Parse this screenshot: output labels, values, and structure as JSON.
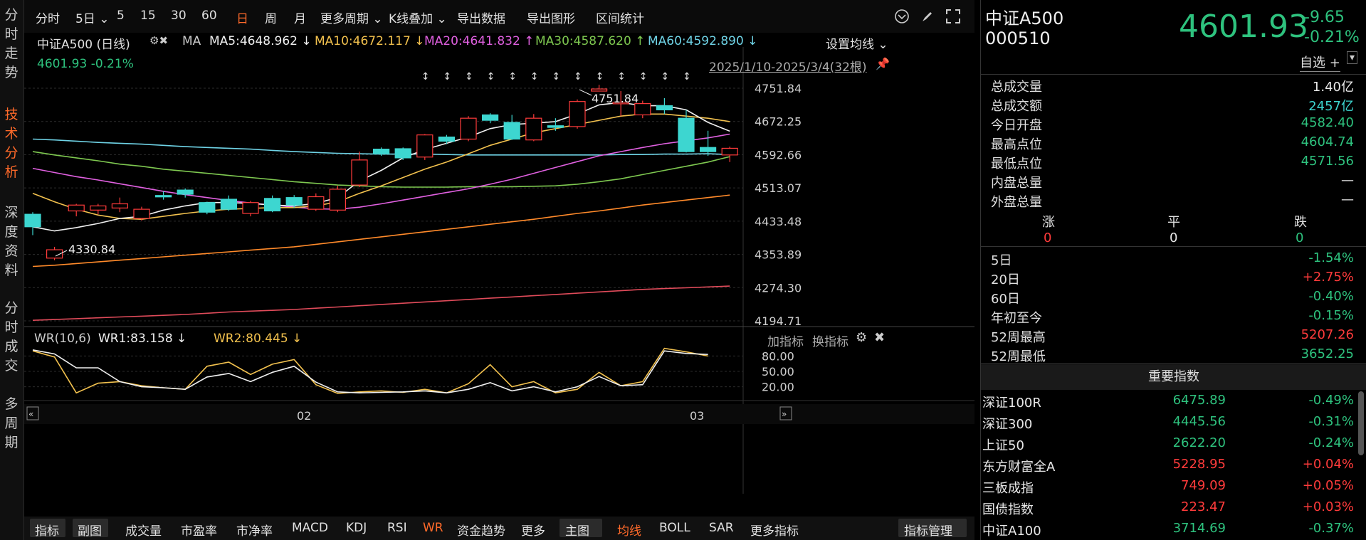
{
  "left_tabs": [
    "分时走势",
    "技术分析",
    "深度资料",
    "分时成交",
    "多周期"
  ],
  "toolbar": {
    "items": [
      "分时",
      "5日 ⌄",
      "5",
      "15",
      "30",
      "60",
      "日",
      "周",
      "月",
      "更多周期 ⌄",
      "K线叠加 ⌄",
      "导出数据",
      "导出图形",
      "区间统计"
    ]
  },
  "chart": {
    "title": "中证A500 (日线)",
    "ma_label": "MA",
    "ma5": "MA5:4648.962 ↓",
    "ma10": "MA10:4672.117 ↓",
    "ma20": "MA20:4641.832 ↑",
    "ma30": "MA30:4587.620 ↑",
    "ma60": "MA60:4592.890 ↓",
    "set_ma": "设置均线 ⌄",
    "last": "4601.93 -0.21%",
    "range": "2025/1/10-2025/3/4(32根)",
    "high_label": "4751.84",
    "low_label": "4330.84",
    "y_ticks": [
      "4751.84",
      "4672.25",
      "4592.66",
      "4513.07",
      "4433.48",
      "4353.89",
      "4274.30",
      "4194.71"
    ],
    "x_ticks": [
      "02",
      "03"
    ],
    "wr_title": "WR(10,6)",
    "wr1": "WR1:83.158 ↓",
    "wr2": "WR2:80.445 ↓",
    "wr_add": "加指标",
    "wr_change": "换指标",
    "wr_ticks": [
      "80.00",
      "50.00",
      "20.00"
    ]
  },
  "chart_data": {
    "type": "candlestick",
    "candles": [
      [
        4450,
        4420,
        4455,
        4400
      ],
      [
        4345,
        4365,
        4372,
        4340
      ],
      [
        4458,
        4472,
        4475,
        4445
      ],
      [
        4460,
        4470,
        4475,
        4450
      ],
      [
        4465,
        4475,
        4490,
        4455
      ],
      [
        4440,
        4462,
        4468,
        4435
      ],
      [
        4495,
        4492,
        4505,
        4485
      ],
      [
        4508,
        4498,
        4512,
        4490
      ],
      [
        4478,
        4455,
        4480,
        4450
      ],
      [
        4486,
        4462,
        4495,
        4458
      ],
      [
        4452,
        4478,
        4482,
        4445
      ],
      [
        4488,
        4458,
        4495,
        4455
      ],
      [
        4490,
        4472,
        4496,
        4465
      ],
      [
        4462,
        4492,
        4500,
        4458
      ],
      [
        4460,
        4510,
        4518,
        4455
      ],
      [
        4520,
        4580,
        4600,
        4515
      ],
      [
        4606,
        4595,
        4610,
        4590
      ],
      [
        4607,
        4585,
        4610,
        4580
      ],
      [
        4587,
        4640,
        4642,
        4580
      ],
      [
        4635,
        4625,
        4640,
        4618
      ],
      [
        4630,
        4680,
        4685,
        4625
      ],
      [
        4688,
        4675,
        4692,
        4668
      ],
      [
        4670,
        4630,
        4688,
        4628
      ],
      [
        4628,
        4680,
        4690,
        4625
      ],
      [
        4662,
        4658,
        4680,
        4650
      ],
      [
        4660,
        4720,
        4725,
        4655
      ],
      [
        4745,
        4750,
        4760,
        4745
      ],
      [
        4715,
        4718,
        4745,
        4685
      ],
      [
        4688,
        4715,
        4722,
        4680
      ],
      [
        4710,
        4700,
        4728,
        4690
      ],
      [
        4680,
        4600,
        4700,
        4598
      ],
      [
        4610,
        4600,
        4650,
        4590
      ],
      [
        4592,
        4608,
        4612,
        4575
      ]
    ],
    "wr1": [
      92,
      84,
      57,
      57,
      30,
      20,
      18,
      15,
      39,
      46,
      30,
      48,
      60,
      29,
      10,
      8,
      9,
      10,
      12,
      8,
      15,
      28,
      12,
      20,
      10,
      20,
      40,
      22,
      24,
      90,
      85,
      83
    ],
    "wr2": [
      90,
      78,
      8,
      27,
      30,
      22,
      18,
      15,
      60,
      68,
      44,
      64,
      73,
      24,
      7,
      10,
      12,
      9,
      15,
      8,
      26,
      63,
      20,
      30,
      8,
      15,
      48,
      22,
      30,
      95,
      88,
      80
    ]
  },
  "bottom_tabs": [
    "指标",
    "副图",
    "成交量",
    "市盈率",
    "市净率",
    "MACD",
    "KDJ",
    "RSI",
    "WR",
    "资金趋势",
    "更多",
    "主图",
    "均线",
    "BOLL",
    "SAR",
    "更多指标",
    "指标管理"
  ],
  "quote": {
    "name": "中证A500",
    "code": "000510",
    "price": "4601.93",
    "chg": "-9.65",
    "pct": "-0.21%",
    "watch": "自选 +"
  },
  "stats": [
    {
      "k": "总成交量",
      "v": "1.40亿",
      "c": "white"
    },
    {
      "k": "总成交额",
      "v": "2457亿",
      "c": "cyan"
    },
    {
      "k": "今日开盘",
      "v": "4582.40",
      "c": "green"
    },
    {
      "k": "最高点位",
      "v": "4604.74",
      "c": "green"
    },
    {
      "k": "最低点位",
      "v": "4571.56",
      "c": "green"
    },
    {
      "k": "内盘总量",
      "v": "—",
      "c": "white"
    },
    {
      "k": "外盘总量",
      "v": "—",
      "c": "white"
    }
  ],
  "breadth": {
    "up_l": "涨",
    "flat_l": "平",
    "down_l": "跌",
    "up": "0",
    "flat": "0",
    "down": "0"
  },
  "periods": [
    {
      "k": "5日",
      "v": "-1.54%",
      "c": "green"
    },
    {
      "k": "20日",
      "v": "+2.75%",
      "c": "red"
    },
    {
      "k": "60日",
      "v": "-0.40%",
      "c": "green"
    },
    {
      "k": "年初至今",
      "v": "-0.15%",
      "c": "green"
    },
    {
      "k": "52周最高",
      "v": "5207.26",
      "c": "red"
    },
    {
      "k": "52周最低",
      "v": "3652.25",
      "c": "green"
    }
  ],
  "indices_title": "重要指数",
  "indices": [
    {
      "n": "深证100R",
      "p": "6475.89",
      "c": "-0.49%",
      "col": "green"
    },
    {
      "n": "深证300",
      "p": "4445.56",
      "c": "-0.31%",
      "col": "green"
    },
    {
      "n": "上证50",
      "p": "2622.20",
      "c": "-0.24%",
      "col": "green"
    },
    {
      "n": "东方财富全A",
      "p": "5228.95",
      "c": "+0.04%",
      "col": "red"
    },
    {
      "n": "三板成指",
      "p": "749.09",
      "c": "+0.05%",
      "col": "red"
    },
    {
      "n": "国债指数",
      "p": "223.47",
      "c": "+0.03%",
      "col": "red"
    },
    {
      "n": "中证A100",
      "p": "3714.69",
      "c": "-0.37%",
      "col": "green"
    }
  ]
}
